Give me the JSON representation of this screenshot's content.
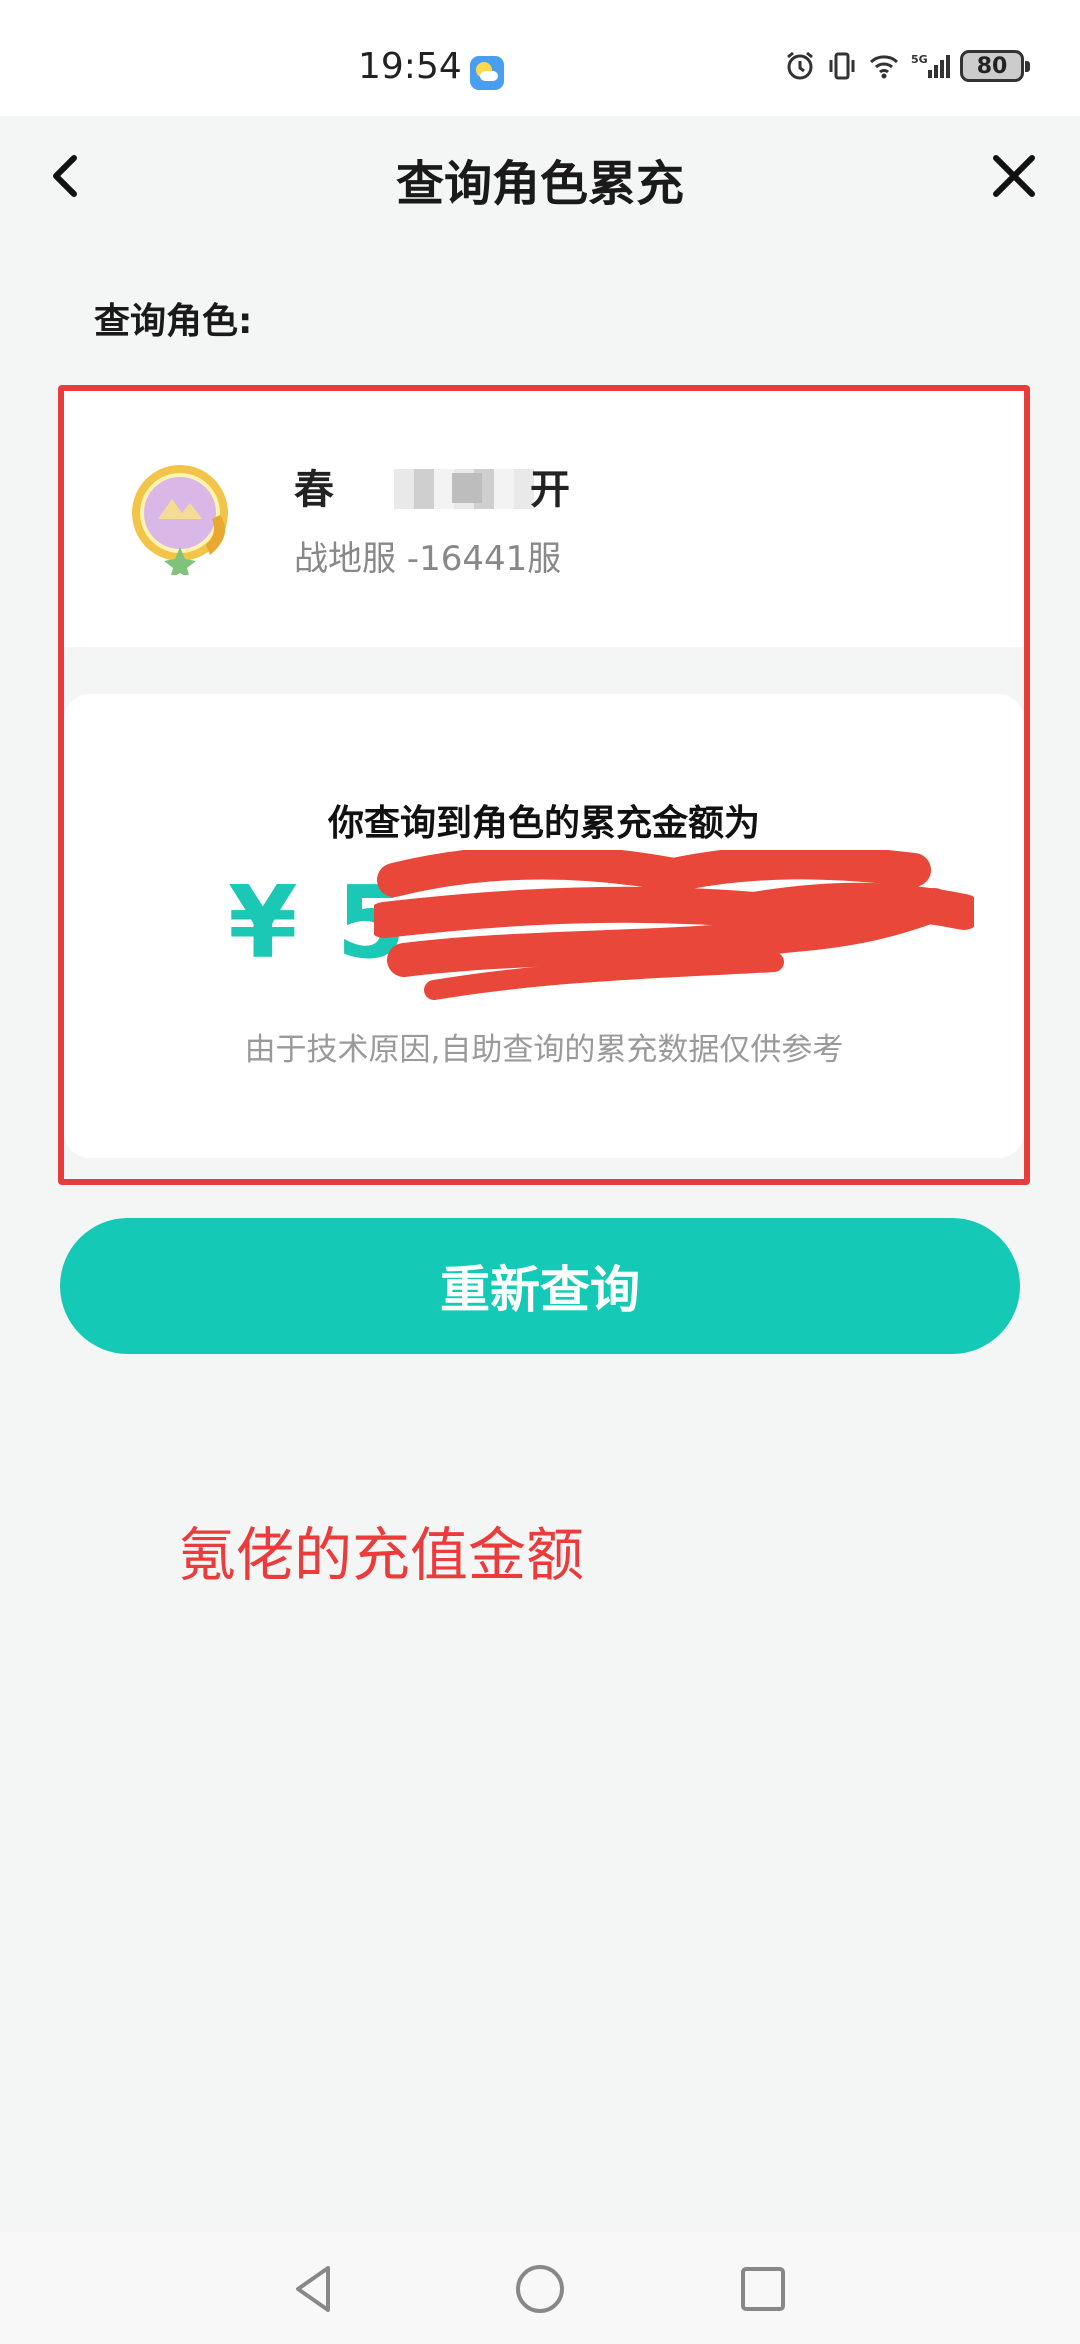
{
  "status_bar": {
    "time": "19:54",
    "battery": "80",
    "icons": [
      "weather-icon",
      "alarm-icon",
      "vibrate-icon",
      "wifi-icon",
      "signal-5g-icon",
      "battery-icon"
    ]
  },
  "header": {
    "title": "查询角色累充",
    "back_icon": "chevron-left-icon",
    "close_icon": "close-icon"
  },
  "section_label": "查询角色:",
  "role": {
    "name_visible_start": "春",
    "name_visible_end": "开",
    "server": "战地服 -16441服"
  },
  "result": {
    "heading": "你查询到角色的累充金额为",
    "amount_visible": "¥ 5",
    "disclaimer": "由于技术原因,自助查询的累充数据仅供参考"
  },
  "requery_button": "重新查询",
  "annotation": "氪佬的充值金额",
  "colors": {
    "accent": "#14c9b6",
    "amount": "#1bc8b5",
    "annotation_red": "#ec3b3b",
    "highlight_border": "#e63c3c"
  }
}
